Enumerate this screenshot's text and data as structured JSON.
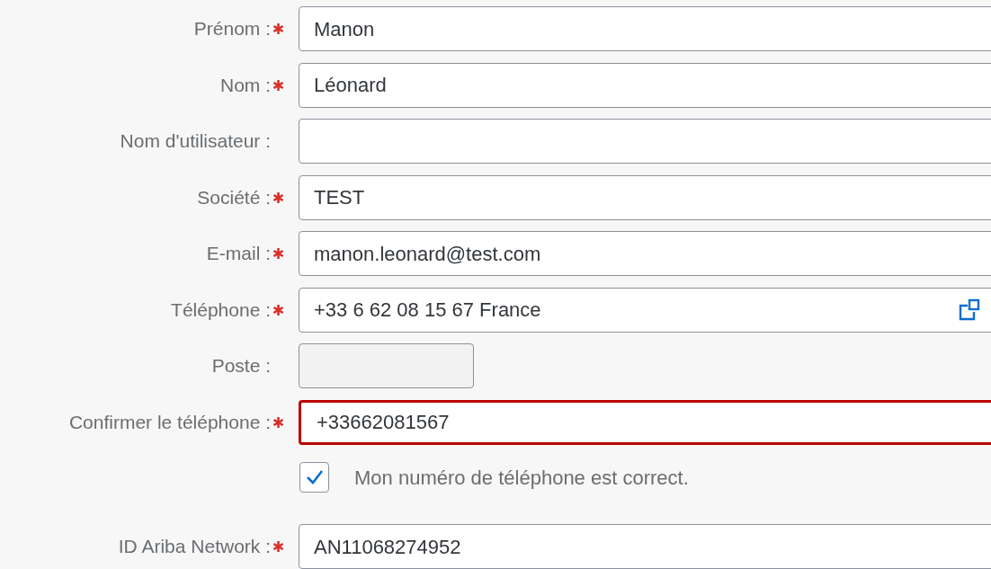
{
  "rows": [
    {
      "kind": "input",
      "label": "Prénom :",
      "required": true,
      "value": "Manon",
      "disabled": false,
      "error": false,
      "short": false,
      "value_help": false
    },
    {
      "kind": "input",
      "label": "Nom :",
      "required": true,
      "value": "Léonard",
      "disabled": false,
      "error": false,
      "short": false,
      "value_help": false
    },
    {
      "kind": "input",
      "label": "Nom d'utilisateur :",
      "required": false,
      "disabled": false,
      "error": false,
      "short": false,
      "value_help": false
    },
    {
      "kind": "input",
      "label": "Société :",
      "required": true,
      "value": "TEST",
      "disabled": false,
      "error": false,
      "short": false,
      "value_help": false
    },
    {
      "kind": "input",
      "label": "E-mail :",
      "required": true,
      "value": "manon.leonard@test.com",
      "disabled": false,
      "error": false,
      "short": false,
      "value_help": false
    },
    {
      "kind": "input",
      "label": "Téléphone :",
      "required": true,
      "value": "+33 6 62 08 15 67 France",
      "disabled": false,
      "error": false,
      "short": false,
      "value_help": true
    },
    {
      "kind": "input",
      "label": "Poste :",
      "required": false,
      "disabled": true,
      "error": false,
      "short": true,
      "value_help": false
    },
    {
      "kind": "input",
      "label": "Confirmer le téléphone :",
      "required": true,
      "value": "+33662081567",
      "disabled": false,
      "error": true,
      "short": false,
      "value_help": false
    },
    {
      "kind": "checkbox",
      "text": "Mon numéro de téléphone est correct.",
      "checked": true
    },
    {
      "kind": "input",
      "label": "ID Ariba Network :",
      "required": true,
      "value": "AN11068274952",
      "disabled": false,
      "error": false,
      "short": false,
      "value_help": false
    }
  ]
}
